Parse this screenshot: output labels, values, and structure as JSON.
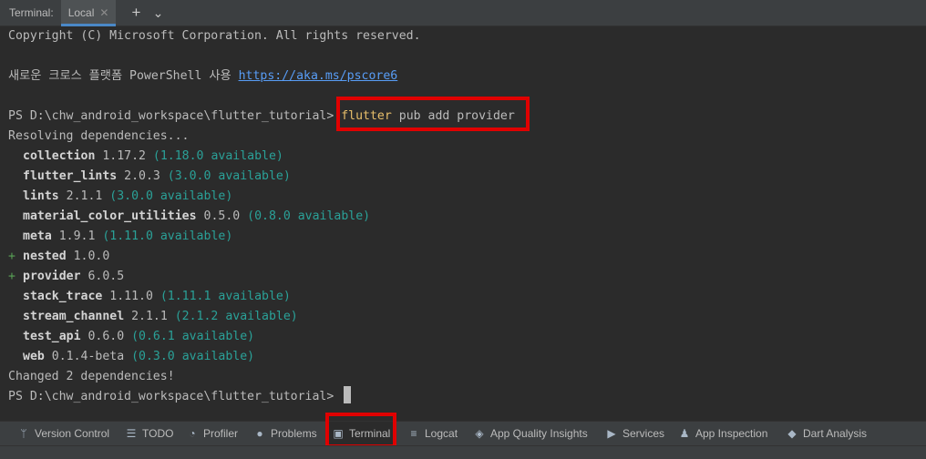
{
  "header": {
    "title": "Terminal:",
    "tab_label": "Local",
    "close_glyph": "✕",
    "add_glyph": "+",
    "dropdown_glyph": "⌄"
  },
  "terminal": {
    "copyright": "Copyright (C) Microsoft Corporation. All rights reserved.",
    "ps_note": "새로운 크로스 플랫폼 PowerShell 사용 ",
    "ps_link": "https://aka.ms/pscore6",
    "prompt": "PS D:\\chw_android_workspace\\flutter_tutorial> ",
    "cmd_word": "flutter",
    "cmd_rest": " pub add provider",
    "resolving": "Resolving dependencies...",
    "packages": [
      {
        "name": "collection",
        "version": " 1.17.2",
        "available": " (1.18.0 available)",
        "added": false
      },
      {
        "name": "flutter_lints",
        "version": " 2.0.3",
        "available": " (3.0.0 available)",
        "added": false
      },
      {
        "name": "lints",
        "version": " 2.1.1",
        "available": " (3.0.0 available)",
        "added": false
      },
      {
        "name": "material_color_utilities",
        "version": " 0.5.0",
        "available": " (0.8.0 available)",
        "added": false
      },
      {
        "name": "meta",
        "version": " 1.9.1",
        "available": " (1.11.0 available)",
        "added": false
      },
      {
        "name": "nested",
        "version": " 1.0.0",
        "available": "",
        "added": true
      },
      {
        "name": "provider",
        "version": " 6.0.5",
        "available": "",
        "added": true
      },
      {
        "name": "stack_trace",
        "version": " 1.11.0",
        "available": " (1.11.1 available)",
        "added": false
      },
      {
        "name": "stream_channel",
        "version": " 2.1.1",
        "available": " (2.1.2 available)",
        "added": false
      },
      {
        "name": "test_api",
        "version": " 0.6.0",
        "available": " (0.6.1 available)",
        "added": false
      },
      {
        "name": "web",
        "version": " 0.1.4-beta",
        "available": " (0.3.0 available)",
        "added": false
      }
    ],
    "changed": "Changed 2 dependencies!",
    "final_prompt": "PS D:\\chw_android_workspace\\flutter_tutorial> ",
    "plus_glyph": "+"
  },
  "toolbar": {
    "items": [
      {
        "label": "Version Control",
        "icon": "branch-icon",
        "glyph": "ᛘ"
      },
      {
        "label": "TODO",
        "icon": "list-icon",
        "glyph": "☰"
      },
      {
        "label": "Profiler",
        "icon": "gauge-icon",
        "glyph": "◔"
      },
      {
        "label": "Problems",
        "icon": "alert-icon",
        "glyph": "●"
      },
      {
        "label": "Terminal",
        "icon": "terminal-icon",
        "glyph": "▣"
      },
      {
        "label": "Logcat",
        "icon": "log-icon",
        "glyph": "≡"
      },
      {
        "label": "App Quality Insights",
        "icon": "diamond-icon",
        "glyph": "◈"
      },
      {
        "label": "Services",
        "icon": "services-icon",
        "glyph": "▶"
      },
      {
        "label": "App Inspection",
        "icon": "inspection-icon",
        "glyph": "♟"
      },
      {
        "label": "Dart Analysis",
        "icon": "dart-icon",
        "glyph": "◆"
      }
    ],
    "active": "Terminal"
  },
  "colors": {
    "background": "#2b2b2b",
    "available_text": "#2aa198",
    "command_text": "#e8bf6a",
    "link": "#589df6",
    "highlight_box": "#e00000",
    "added_plus": "#58a156"
  }
}
